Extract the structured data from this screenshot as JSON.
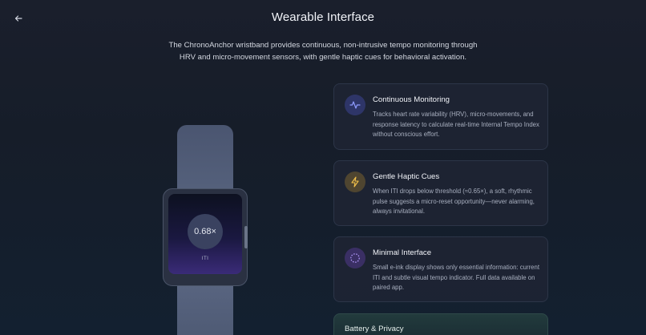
{
  "header": {
    "title": "Wearable Interface"
  },
  "intro": {
    "text": "The ChronoAnchor wristband provides continuous, non-intrusive tempo monitoring through HRV and micro-movement sensors, with gentle haptic cues for behavioral activation."
  },
  "watch": {
    "iti_value": "0.68×",
    "iti_label": "ITI"
  },
  "features": [
    {
      "title": "Continuous Monitoring",
      "description": "Tracks heart rate variability (HRV), micro-movements, and response latency to calculate real-time Internal Tempo Index without conscious effort.",
      "icon": "activity-icon",
      "icon_color": "#8f9bff",
      "icon_bg": "#2e3568"
    },
    {
      "title": "Gentle Haptic Cues",
      "description": "When ITI drops below threshold (≈0.65×), a soft, rhythmic pulse suggests a micro-reset opportunity—never alarming, always invitational.",
      "icon": "lightning-icon",
      "icon_color": "#f2c04a",
      "icon_bg": "#4f4530"
    },
    {
      "title": "Minimal Interface",
      "description": "Small e-ink display shows only essential information: current ITI and subtle visual tempo indicator. Full data available on paired app.",
      "icon": "dotted-circle-icon",
      "icon_color": "#b59cff",
      "icon_bg": "#3a2f64"
    }
  ],
  "battery_card": {
    "title": "Battery & Privacy"
  }
}
